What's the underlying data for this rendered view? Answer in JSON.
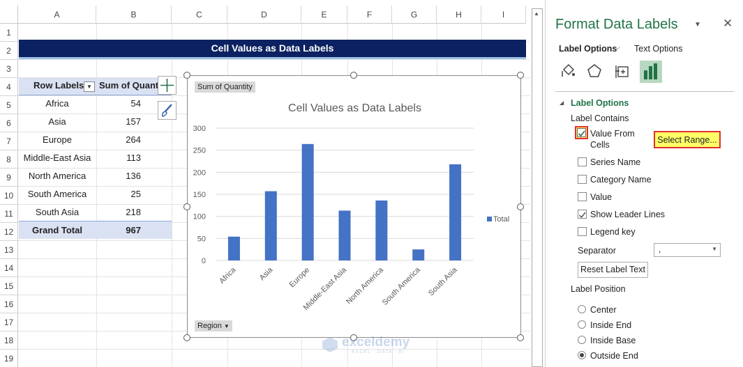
{
  "columns": [
    "A",
    "B",
    "C",
    "D",
    "E",
    "F",
    "G",
    "H",
    "I"
  ],
  "rows": [
    "1",
    "2",
    "3",
    "4",
    "5",
    "6",
    "7",
    "8",
    "9",
    "10",
    "11",
    "12",
    "13",
    "14",
    "15",
    "16",
    "17",
    "18",
    "19"
  ],
  "banner": "Cell Values as Data Labels",
  "pivot": {
    "header_row_labels": "Row Labels",
    "header_sum": "Sum of Quant",
    "rows": [
      {
        "label": "Africa",
        "value": "54"
      },
      {
        "label": "Asia",
        "value": "157"
      },
      {
        "label": "Europe",
        "value": "264"
      },
      {
        "label": "Middle-East Asia",
        "value": "113"
      },
      {
        "label": "North America",
        "value": "136"
      },
      {
        "label": "South America",
        "value": "25"
      },
      {
        "label": "South Asia",
        "value": "218"
      }
    ],
    "total_label": "Grand Total",
    "total_value": "967"
  },
  "chart_data": {
    "type": "bar",
    "title": "Cell Values as Data Labels",
    "categories": [
      "Africa",
      "Asia",
      "Europe",
      "Middle-East Asia",
      "North America",
      "South America",
      "South Asia"
    ],
    "series": [
      {
        "name": "Total",
        "values": [
          54,
          157,
          264,
          113,
          136,
          25,
          218
        ],
        "color": "#4472c4"
      }
    ],
    "ylim": [
      0,
      300
    ],
    "yticks": [
      "0",
      "50",
      "100",
      "150",
      "200",
      "250",
      "300"
    ],
    "grid": true,
    "legend": "right"
  },
  "chart_chips": {
    "field": "Sum of Quantity",
    "axis": "Region"
  },
  "panel": {
    "title": "Format Data Labels",
    "tab_label_options": "Label Options",
    "tab_text_options": "Text Options",
    "section": "Label Options",
    "label_contains": "Label Contains",
    "value_from": "Value From",
    "cells": "Cells",
    "select_range": "Select Range...",
    "series_name": "Series Name",
    "category_name": "Category Name",
    "value": "Value",
    "show_leader": "Show Leader Lines",
    "legend_key": "Legend key",
    "separator": "Separator",
    "separator_value": ",",
    "reset": "Reset Label Text",
    "label_position": "Label Position",
    "pos_center": "Center",
    "pos_inside_end": "Inside End",
    "pos_inside_base": "Inside Base",
    "pos_outside_end": "Outside End"
  },
  "watermark": {
    "name": "exceldemy",
    "tagline": "EXCEL · DATA · BI"
  },
  "colors": {
    "accent": "#217346",
    "banner": "#0b2161",
    "bar": "#4472c4",
    "highlight": "#ffff66",
    "highlight_border": "#e03030"
  }
}
